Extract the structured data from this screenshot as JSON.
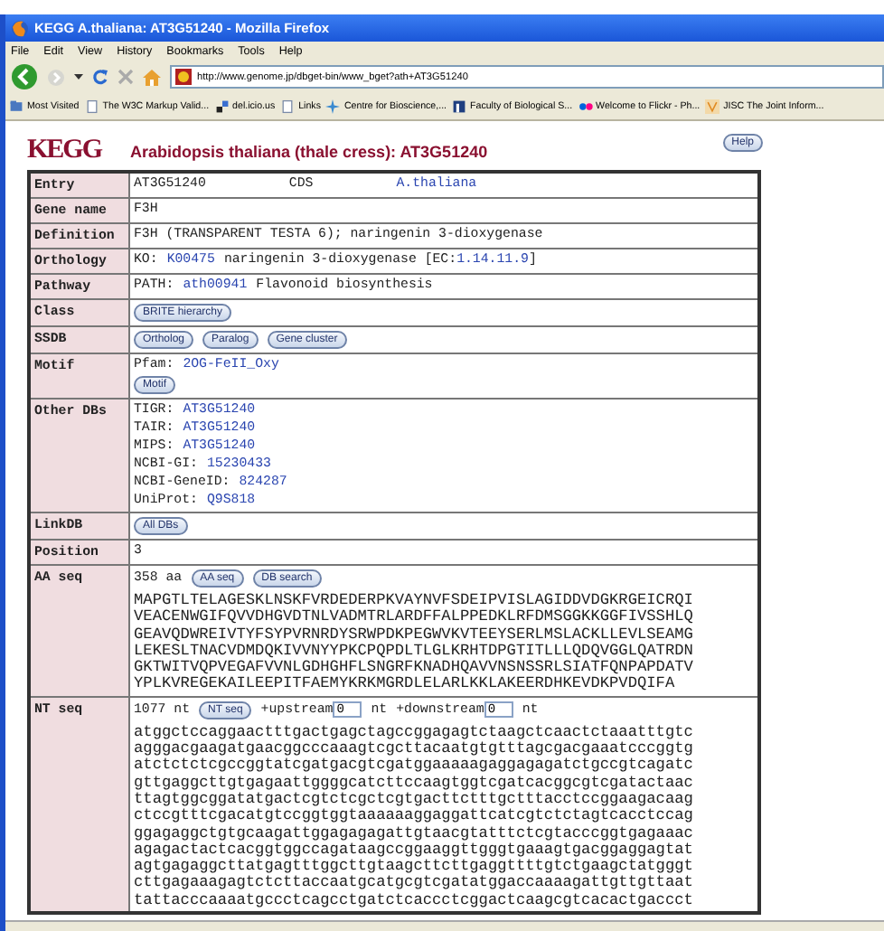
{
  "window": {
    "title": "KEGG A.thaliana: AT3G51240 - Mozilla Firefox"
  },
  "menu": [
    "File",
    "Edit",
    "View",
    "History",
    "Bookmarks",
    "Tools",
    "Help"
  ],
  "toolbar": {
    "url": "http://www.genome.jp/dbget-bin/www_bget?ath+AT3G51240"
  },
  "bookmarks": [
    {
      "label": "Most Visited",
      "kind": "folder"
    },
    {
      "label": "The W3C Markup Valid...",
      "kind": "page"
    },
    {
      "label": "del.icio.us",
      "kind": "squares"
    },
    {
      "label": "Links",
      "kind": "page"
    },
    {
      "label": "Centre for Bioscience,...",
      "kind": "star"
    },
    {
      "label": "Faculty of Biological S...",
      "kind": "block"
    },
    {
      "label": "Welcome to Flickr - Ph...",
      "kind": "dots"
    },
    {
      "label": "JISC The Joint Inform...",
      "kind": "jisc"
    }
  ],
  "page": {
    "logo": "KEGG",
    "title": "Arabidopsis thaliana (thale cress): AT3G51240",
    "help_button": "Help",
    "rows": [
      {
        "label": "Entry",
        "blocks": [
          {
            "kind": "line",
            "spread": true,
            "segments": [
              {
                "kind": "text",
                "text": "AT3G51240"
              },
              {
                "kind": "text",
                "text": "CDS"
              },
              {
                "kind": "link",
                "text": "A.thaliana"
              }
            ]
          }
        ]
      },
      {
        "label": "Gene name",
        "blocks": [
          {
            "kind": "line",
            "segments": [
              {
                "kind": "text",
                "text": "F3H"
              }
            ]
          }
        ]
      },
      {
        "label": "Definition",
        "blocks": [
          {
            "kind": "line",
            "segments": [
              {
                "kind": "text",
                "text": "F3H (TRANSPARENT TESTA 6); naringenin 3-dioxygenase"
              }
            ]
          }
        ]
      },
      {
        "label": "Orthology",
        "blocks": [
          {
            "kind": "line",
            "segments": [
              {
                "kind": "text",
                "text": "KO:"
              },
              {
                "kind": "link",
                "text": "K00475"
              },
              {
                "kind": "group",
                "parts": [
                  {
                    "kind": "text",
                    "text": "naringenin 3-dioxygenase [EC:"
                  },
                  {
                    "kind": "link",
                    "text": "1.14.11.9"
                  },
                  {
                    "kind": "text",
                    "text": "]"
                  }
                ]
              }
            ]
          }
        ]
      },
      {
        "label": "Pathway",
        "blocks": [
          {
            "kind": "line",
            "segments": [
              {
                "kind": "text",
                "text": "PATH:"
              },
              {
                "kind": "link",
                "text": "ath00941"
              },
              {
                "kind": "text",
                "text": "Flavonoid biosynthesis"
              }
            ]
          }
        ]
      },
      {
        "label": "Class",
        "blocks": [
          {
            "kind": "line",
            "segments": [
              {
                "kind": "button",
                "text": "BRITE hierarchy"
              }
            ]
          }
        ]
      },
      {
        "label": "SSDB",
        "blocks": [
          {
            "kind": "line",
            "segments": [
              {
                "kind": "button",
                "text": "Ortholog"
              },
              {
                "kind": "button",
                "text": "Paralog"
              },
              {
                "kind": "button",
                "text": "Gene cluster"
              }
            ]
          }
        ]
      },
      {
        "label": "Motif",
        "blocks": [
          {
            "kind": "line",
            "segments": [
              {
                "kind": "text",
                "text": "Pfam:"
              },
              {
                "kind": "link",
                "text": "2OG-FeII_Oxy"
              }
            ]
          },
          {
            "kind": "line",
            "segments": [
              {
                "kind": "button",
                "text": "Motif"
              }
            ]
          }
        ]
      },
      {
        "label": "Other DBs",
        "blocks": [
          {
            "kind": "line",
            "segments": [
              {
                "kind": "text",
                "text": "TIGR:"
              },
              {
                "kind": "link",
                "text": "AT3G51240"
              }
            ]
          },
          {
            "kind": "line",
            "segments": [
              {
                "kind": "text",
                "text": "TAIR:"
              },
              {
                "kind": "link",
                "text": "AT3G51240"
              }
            ]
          },
          {
            "kind": "line",
            "segments": [
              {
                "kind": "text",
                "text": "MIPS:"
              },
              {
                "kind": "link",
                "text": "AT3G51240"
              }
            ]
          },
          {
            "kind": "line",
            "segments": [
              {
                "kind": "text",
                "text": "NCBI-GI:"
              },
              {
                "kind": "link",
                "text": "15230433"
              }
            ]
          },
          {
            "kind": "line",
            "segments": [
              {
                "kind": "text",
                "text": "NCBI-GeneID:"
              },
              {
                "kind": "link",
                "text": "824287"
              }
            ]
          },
          {
            "kind": "line",
            "segments": [
              {
                "kind": "text",
                "text": "UniProt:"
              },
              {
                "kind": "link",
                "text": "Q9S818"
              }
            ]
          }
        ]
      },
      {
        "label": "LinkDB",
        "blocks": [
          {
            "kind": "line",
            "segments": [
              {
                "kind": "button",
                "text": "All DBs"
              }
            ]
          }
        ]
      },
      {
        "label": "Position",
        "blocks": [
          {
            "kind": "line",
            "segments": [
              {
                "kind": "text",
                "text": "3"
              }
            ]
          }
        ]
      },
      {
        "label": "AA seq",
        "blocks": [
          {
            "kind": "line",
            "segments": [
              {
                "kind": "text",
                "text": "358 aa"
              },
              {
                "kind": "button",
                "text": "AA seq"
              },
              {
                "kind": "button",
                "text": "DB search"
              }
            ]
          },
          {
            "kind": "seq",
            "lines": [
              "MAPGTLTELAGESKLNSKFVRDEDERPKVAYNVFSDEIPVISLAGIDDVDGKRGEICRQI",
              "VEACENWGIFQVVDHGVDTNLVADMTRLARDFFALPPEDKLRFDMSGGKKGGFIVSSHLQ",
              "GEAVQDWREIVTYFSYPVRNRDYSRWPDKPEGWVKVTEEYSERLMSLACKLLEVLSEAMG",
              "LEKESLTNACVDMDQKIVVNYYPKCPQPDLTLGLKRHTDPGTITLLLQDQVGGLQATRDN",
              "GKTWITVQPVEGAFVVNLGDHGHFLSNGRFKNADHQAVVNSNSSRLSIATFQNPAPDATV",
              "YPLKVREGEKAILEEPITFAEMYKRKMGRDLELARLKKLAKEERDHKEVDKPVDQIFA"
            ]
          }
        ]
      },
      {
        "label": "NT seq",
        "blocks": [
          {
            "kind": "line",
            "segments": [
              {
                "kind": "text",
                "text": "1077 nt"
              },
              {
                "kind": "button",
                "text": "NT seq"
              },
              {
                "kind": "group",
                "parts": [
                  {
                    "kind": "text",
                    "text": "+upstream"
                  },
                  {
                    "kind": "field",
                    "text": "0"
                  }
                ]
              },
              {
                "kind": "text",
                "text": "nt"
              },
              {
                "kind": "group",
                "parts": [
                  {
                    "kind": "text",
                    "text": "+downstream"
                  },
                  {
                    "kind": "field",
                    "text": "0"
                  }
                ]
              },
              {
                "kind": "text",
                "text": "nt"
              }
            ]
          },
          {
            "kind": "seq",
            "lines": [
              "atggctccaggaactttgactgagctagccggagagtctaagctcaactctaaatttgtc",
              "agggacgaagatgaacggcccaaagtcgcttacaatgtgtttagcgacgaaatcccggtg",
              "atctctctcgccggtatcgatgacgtcgatggaaaaagaggagagatctgccgtcagatc",
              "gttgaggcttgtgagaattggggcatcttccaagtggtcgatcacggcgtcgatactaac",
              "ttagtggcggatatgactcgtctcgctcgtgacttctttgctttacctccggaagacaag",
              "ctccgtttcgacatgtccggtggtaaaaaaggaggattcatcgtctctagtcacctccag",
              "ggagaggctgtgcaagattggagagagattgtaacgtatttctcgtacccggtgagaaac",
              "agagactactcacggtggccagataagccggaaggttgggtgaaagtgacggaggagtat",
              "agtgagaggcttatgagtttggcttgtaagcttcttgaggttttgtctgaagctatgggt",
              "cttgagaaagagtctcttaccaatgcatgcgtcgatatggaccaaaagattgttgttaat",
              "tattacccaaaatgccctcagcctgatctcaccctcggactcaagcgtcacactgaccct"
            ]
          }
        ]
      }
    ]
  }
}
